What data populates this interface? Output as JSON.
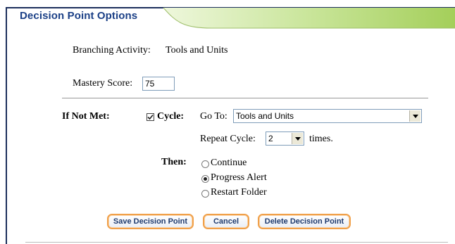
{
  "panel": {
    "title": "Decision Point Options",
    "accent_color": "#a4cf5a",
    "title_color": "#1a3f86"
  },
  "branching": {
    "label": "Branching Activity:",
    "value": "Tools and Units"
  },
  "mastery": {
    "label": "Mastery Score:",
    "value": "75"
  },
  "if_not_met": {
    "label": "If Not Met:",
    "cycle_label": "Cycle:",
    "cycle_checked": true,
    "goto_label": "Go To:",
    "goto_value": "Tools and Units",
    "repeat_label": "Repeat Cycle:",
    "repeat_value": "2",
    "times_label": "times."
  },
  "then": {
    "label": "Then:",
    "options": [
      {
        "label": "Continue",
        "selected": false
      },
      {
        "label": "Progress Alert",
        "selected": true
      },
      {
        "label": "Restart Folder",
        "selected": false
      }
    ]
  },
  "buttons": {
    "save": "Save Decision Point",
    "cancel": "Cancel",
    "delete": "Delete Decision Point"
  }
}
